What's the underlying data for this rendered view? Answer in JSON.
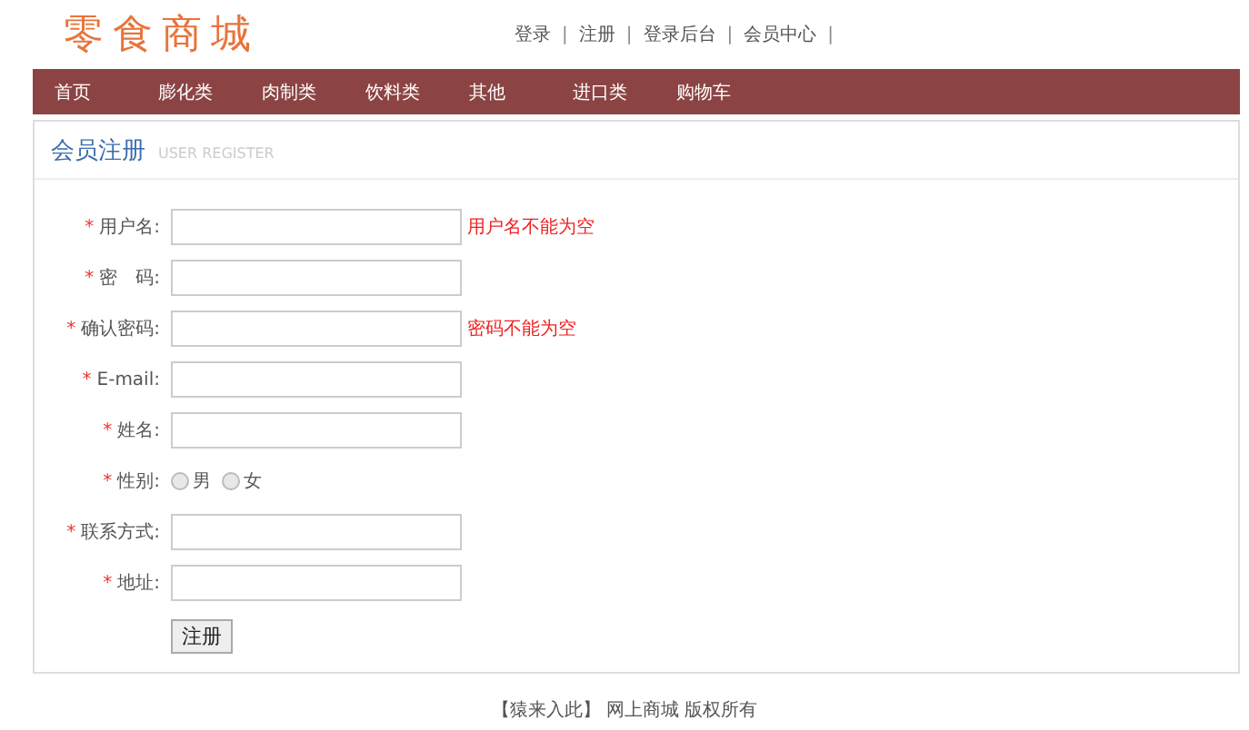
{
  "logo": "零食商城",
  "top_links": [
    {
      "kind": "link",
      "text": "登录"
    },
    {
      "kind": "separator",
      "text": "|"
    },
    {
      "kind": "link",
      "text": "注册"
    },
    {
      "kind": "separator",
      "text": "|"
    },
    {
      "kind": "link",
      "text": "登录后台"
    },
    {
      "kind": "separator",
      "text": "|"
    },
    {
      "kind": "link",
      "text": "会员中心"
    },
    {
      "kind": "separator",
      "text": "|"
    }
  ],
  "nav": [
    "首页",
    "膨化类",
    "肉制类",
    "饮料类",
    "其他",
    "进口类",
    "购物车"
  ],
  "panel": {
    "title": "会员注册",
    "subtitle": "USER REGISTER"
  },
  "fields": [
    {
      "kind": "input",
      "required_mark": "*",
      "label": "用户名:",
      "error": "用户名不能为空"
    },
    {
      "kind": "input",
      "required_mark": "*",
      "label": "密　码:"
    },
    {
      "kind": "input",
      "required_mark": "*",
      "label": "确认密码:",
      "error": "密码不能为空"
    },
    {
      "kind": "input",
      "required_mark": "*",
      "label": "E-mail:"
    },
    {
      "kind": "input",
      "required_mark": "*",
      "label": "姓名:"
    },
    {
      "kind": "radio",
      "required_mark": "*",
      "label": "性别:",
      "options": [
        {
          "label": "男",
          "selected": false
        },
        {
          "label": "女",
          "selected": false
        }
      ]
    },
    {
      "kind": "input",
      "required_mark": "*",
      "label": "联系方式:"
    },
    {
      "kind": "input",
      "required_mark": "*",
      "label": "地址:"
    }
  ],
  "submit": "注册",
  "footer": "【猿来入此】 网上商城 版权所有"
}
